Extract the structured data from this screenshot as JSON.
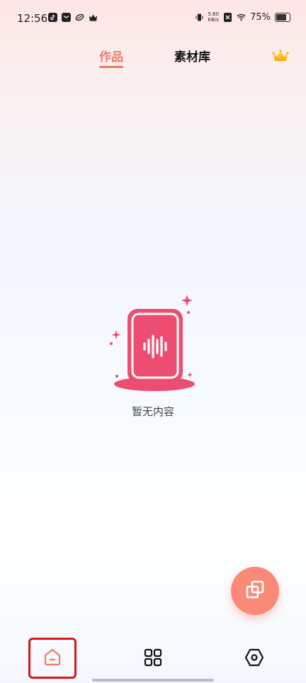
{
  "status_bar": {
    "time": "12:56",
    "net_speed_value": "5.60",
    "net_speed_unit": "KB/s",
    "battery_percent": "75%",
    "icons_left": [
      "tiktok-icon",
      "mail-icon",
      "link-icon",
      "crown-small-icon"
    ],
    "icons_right": [
      "vibrate-icon",
      "sim-x-icon",
      "wifi-icon",
      "battery-icon"
    ]
  },
  "top_tabs": {
    "active": "作品",
    "items": [
      {
        "label": "作品",
        "active": true
      },
      {
        "label": "素材库",
        "active": false
      }
    ],
    "vip_icon": "crown-icon"
  },
  "empty_state": {
    "text": "暂无内容",
    "illustration": "voice-device-icon"
  },
  "fab": {
    "icon": "copy-icon"
  },
  "bottom_nav": {
    "items": [
      {
        "icon": "home-icon",
        "active": true
      },
      {
        "icon": "grid-icon",
        "active": false
      },
      {
        "icon": "hexagon-settings-icon",
        "active": false
      }
    ]
  },
  "colors": {
    "accent": "#ef7a66",
    "illustration": "#ee4d72",
    "fab": "#f98a78",
    "highlight_box": "#d5181c"
  }
}
